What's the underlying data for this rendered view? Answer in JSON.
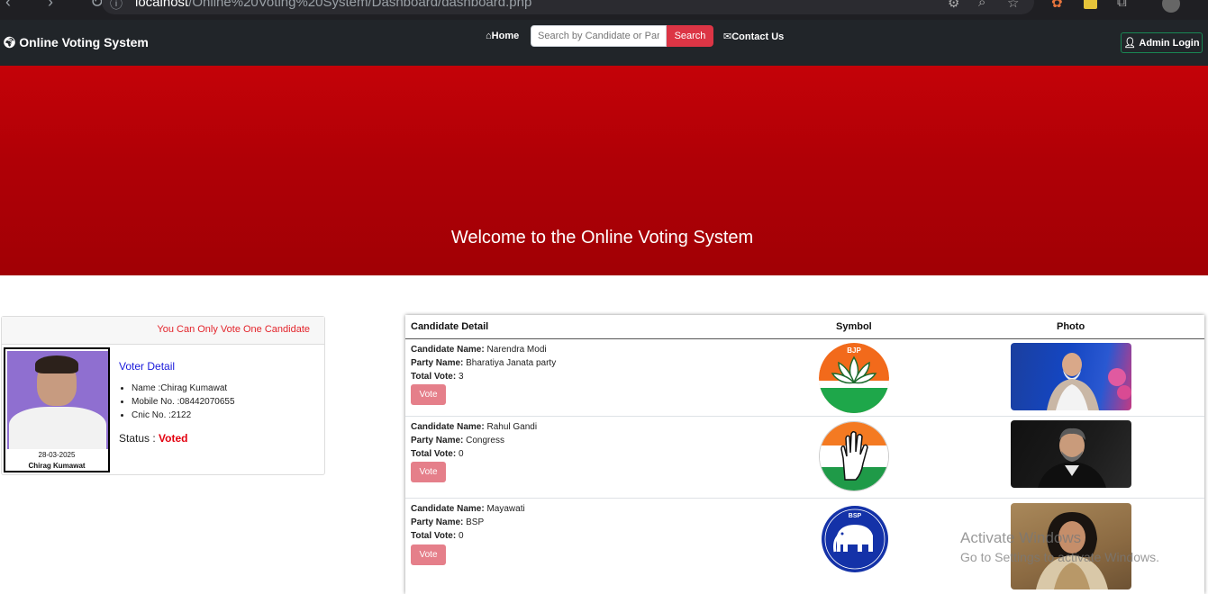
{
  "browser": {
    "url_host": "localhost",
    "url_path": "/Online%20Voting%20System/Dashboard/dashboard.php"
  },
  "navbar": {
    "brand": "Online Voting System",
    "home_label": "Home",
    "search_placeholder": "Search by Candidate or Party",
    "search_button": "Search",
    "contact_label": "Contact Us",
    "admin_label": "Admin Login"
  },
  "hero": {
    "title": "Welcome to the Online Voting System",
    "color": "#b70006"
  },
  "voter": {
    "warning": "You Can Only Vote One Candidate",
    "photo_date": "28-03-2025",
    "photo_name": "Chirag Kumawat",
    "detail_title": "Voter Detail",
    "fields": [
      {
        "text": "Name :Chirag Kumawat"
      },
      {
        "text": "Mobile No. :08442070655"
      },
      {
        "text": "Cnic No. :2122"
      }
    ],
    "status_label": "Status : ",
    "status_value": "Voted",
    "status_color": "#e3000f"
  },
  "table": {
    "headers": {
      "detail": "Candidate Detail",
      "symbol": "Symbol",
      "photo": "Photo"
    },
    "labels": {
      "name": "Candidate Name:",
      "party": "Party Name:",
      "votes": "Total Vote:",
      "vote_button": "Vote"
    },
    "candidates": [
      {
        "name": "Narendra Modi",
        "party": "Bharatiya Janata party",
        "votes": "3",
        "symbol_icon": "bjp-lotus-icon",
        "symbol_text": "BJP"
      },
      {
        "name": "Rahul Gandi",
        "party": "Congress",
        "votes": "0",
        "symbol_icon": "congress-hand-icon",
        "symbol_text": ""
      },
      {
        "name": "Mayawati",
        "party": "BSP",
        "votes": "0",
        "symbol_icon": "bsp-elephant-icon",
        "symbol_text": "BSP"
      }
    ]
  },
  "watermark": {
    "line1": "Activate Windows",
    "line2": "Go to Settings to activate Windows."
  }
}
